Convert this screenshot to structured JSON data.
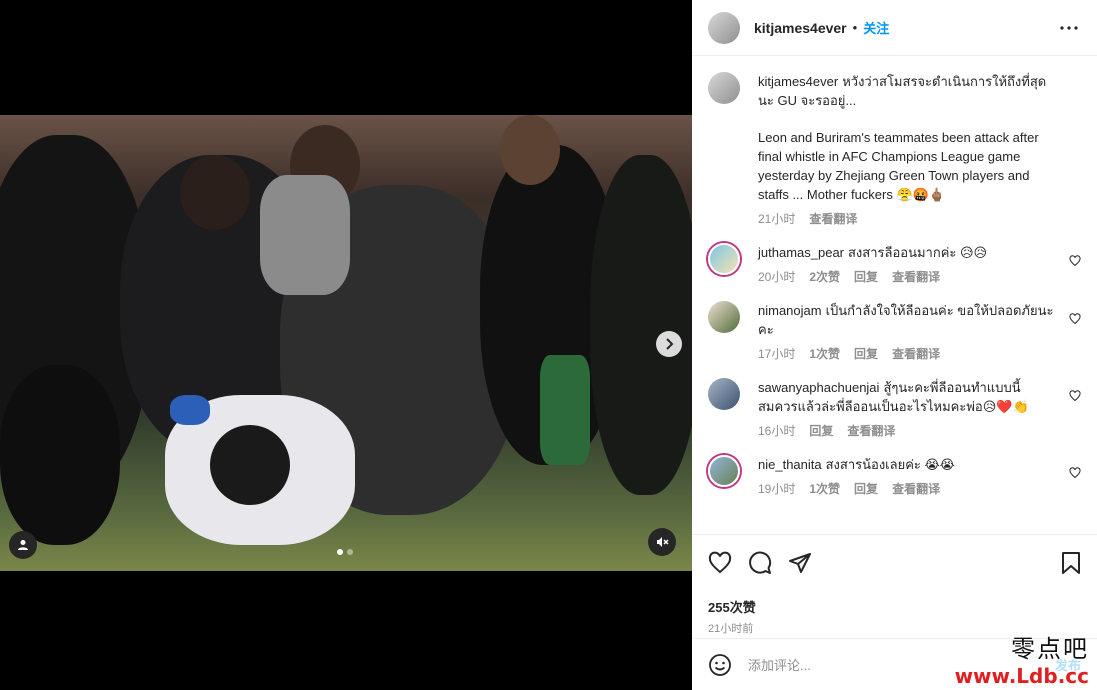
{
  "post": {
    "username": "kitjames4ever",
    "separator": "•",
    "follow_label": "关注"
  },
  "caption": {
    "username": "kitjames4ever",
    "text_thai": "หวังว่าสโมสรจะดำเนินการให้ถึงที่สุดนะ GU จะรออยู่...",
    "text_en": "Leon and Buriram's teammates been attack after final whistle in AFC Champions League game yesterday by Zhejiang Green Town players and staffs ... Mother fuckers 😤🤬🖕🏽",
    "time": "21小时",
    "translate": "查看翻译"
  },
  "comments": [
    {
      "username": "juthamas_pear",
      "text": "สงสารลีออนมากค่ะ 😥😥",
      "time": "20小时",
      "likes": "2次赞",
      "reply": "回复",
      "translate": "查看翻译"
    },
    {
      "username": "nimanojam",
      "text": "เป็นกำลังใจให้ลีออนค่ะ ขอให้ปลอดภัยนะคะ",
      "time": "17小时",
      "likes": "1次赞",
      "reply": "回复",
      "translate": "查看翻译"
    },
    {
      "username": "sawanyaphachuenjai",
      "text": "สู้ๆนะคะพี่ลีออนทำแบบนี้สมควรแล้วล่ะพี่ลีออนเป็นอะไรไหมคะพ่อ😥❤️👏",
      "time": "16小时",
      "likes": "",
      "reply": "回复",
      "translate": "查看翻译"
    },
    {
      "username": "nie_thanita",
      "text": "สงสารน้องเลยค่ะ 😭😭",
      "time": "19小时",
      "likes": "1次赞",
      "reply": "回复",
      "translate": "查看翻译"
    }
  ],
  "actions": {
    "likes_count": "255次赞",
    "timestamp": "21小时前"
  },
  "add_comment": {
    "placeholder": "添加评论...",
    "post_label": "发布"
  },
  "watermark": {
    "line1": "零点吧",
    "line2": "www.Ldb.cc"
  },
  "carousel": {
    "total": 2,
    "active": 1
  },
  "colors": {
    "accent": "#0095f6",
    "muted": "#8e8e8e",
    "story_ring": "#c13584"
  }
}
